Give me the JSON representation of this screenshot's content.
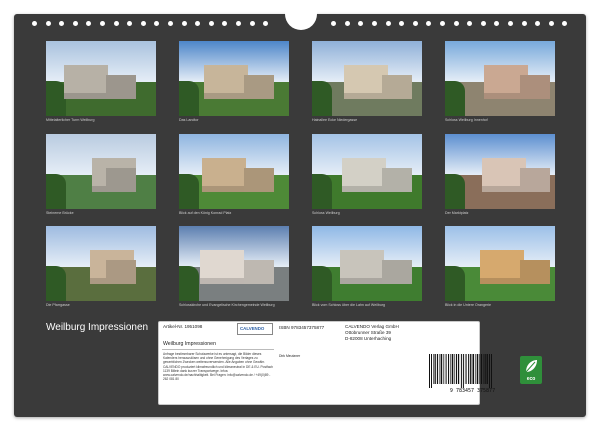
{
  "calendar": {
    "title": "Weilburg Impressionen",
    "photos": [
      {
        "caption": "Mittelalterlicher Turm Weilburg",
        "sky": "#a9c2de",
        "ground": "#3f6b2e",
        "b": "#b7b1a6"
      },
      {
        "caption": "Das Landtor",
        "sky": "#4d86c9",
        "ground": "#4a7a34",
        "b": "#c7b59a"
      },
      {
        "caption": "Hainallee Ecke Niedergasse",
        "sky": "#8fb0d8",
        "ground": "#6f7b5f",
        "b": "#d5c8b1"
      },
      {
        "caption": "Schloss Weilburg Innenhof",
        "sky": "#78a9db",
        "ground": "#8e8470",
        "b": "#caa892"
      },
      {
        "caption": "Steinerne Brücke",
        "sky": "#b9cbe0",
        "ground": "#4f7f45",
        "b": "#b9b3a8"
      },
      {
        "caption": "Blick auf den König Konrad Platz",
        "sky": "#8fb5e0",
        "ground": "#4e8a37",
        "b": "#c9b08e"
      },
      {
        "caption": "Schloss Weilburg",
        "sky": "#a4c3e6",
        "ground": "#3f7a2c",
        "b": "#d3d0c6"
      },
      {
        "caption": "Der Marktplatz",
        "sky": "#5c8fd0",
        "ground": "#8a6e5a",
        "b": "#d9c5b6"
      },
      {
        "caption": "Die Pfarrgasse",
        "sky": "#9ebbe0",
        "ground": "#5a6e3e",
        "b": "#c9b49a"
      },
      {
        "caption": "Schlosskirche und Evangelische Kirchengemeinde Weilburg",
        "sky": "#5c7fb0",
        "ground": "#7a7f80",
        "b": "#e0d8d0"
      },
      {
        "caption": "Blick vom Schloss über die Lahn auf Weilburg",
        "sky": "#8fb8e6",
        "ground": "#3f7d30",
        "b": "#c8c4bb"
      },
      {
        "caption": "Blick in die Untere Orangerie",
        "sky": "#9cc0e8",
        "ground": "#4a8a38",
        "b": "#d6a96e"
      }
    ]
  },
  "info": {
    "article_label": "Artikel-Nr. 1951098",
    "isbn_label": "ISBN 9783457375877",
    "publisher_lines": [
      "CALVENDO Verlag GmbH",
      "Ottobrunner Straße 39",
      "D-82008 Unterhaching"
    ],
    "product_title": "Weilburg Impressionen",
    "author": "Dirk Meutzner",
    "logo_text": "CALVENDO",
    "description": "Anfrage bestimmbarer Schutzwerke ist es untersagt, die Bilder dieses Kalenders herauszulösen und ohne Genehmigung des Verlages zu gewerblichen Zwecken weiterzuverwenden. Alle Angaben ohne Gewähr. CALVENDO produziert klimafreundlich und klimaneutral in DE & EU. Postfach 1139 Billein dank kurzer Transportwege. Infos: www.calvendo.de/nachhaltigkeit. Bei Fragen: info@calvendo.de / +49(0)89 - 262 081 80",
    "barcode_number": "9 783457 375877",
    "eco_label": "eco"
  },
  "colors": {
    "calendar_bg": "#3a3a3a",
    "eco_green": "#2f8f3a"
  }
}
